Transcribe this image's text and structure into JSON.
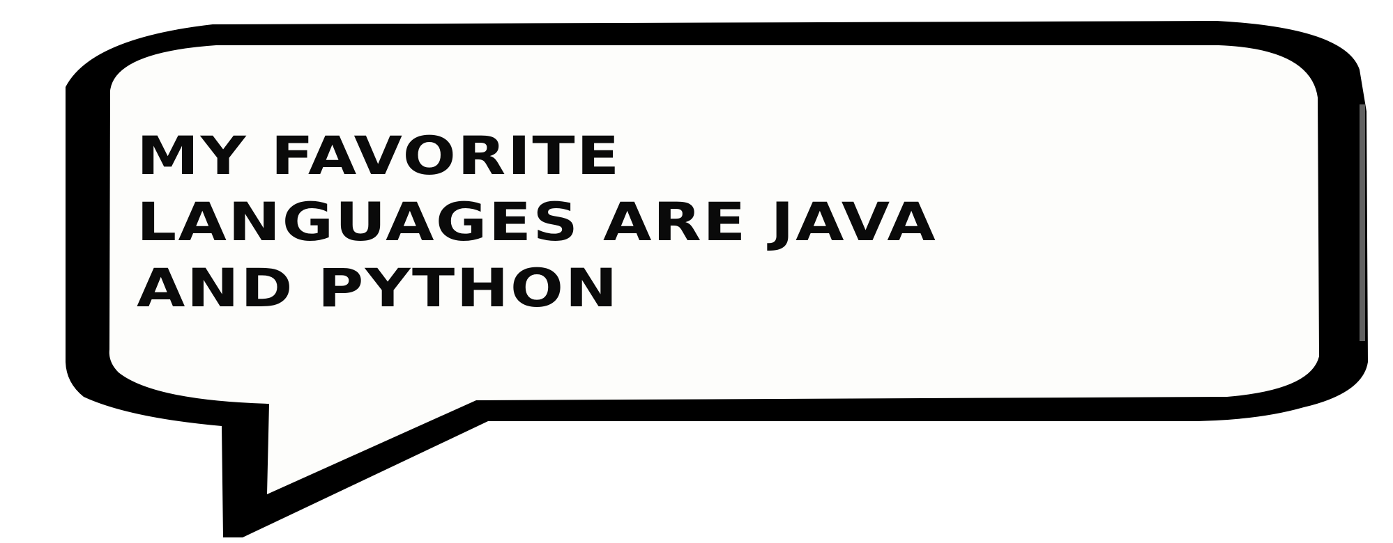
{
  "speech_bubble": {
    "lines": [
      "MY FAVORITE",
      "LANGUAGES ARE JAVA",
      "AND PYTHON"
    ],
    "colors": {
      "fill": "#fdfdfb",
      "outline": "#000000",
      "shadow": "#111111",
      "text": "#0a0a0a"
    }
  }
}
